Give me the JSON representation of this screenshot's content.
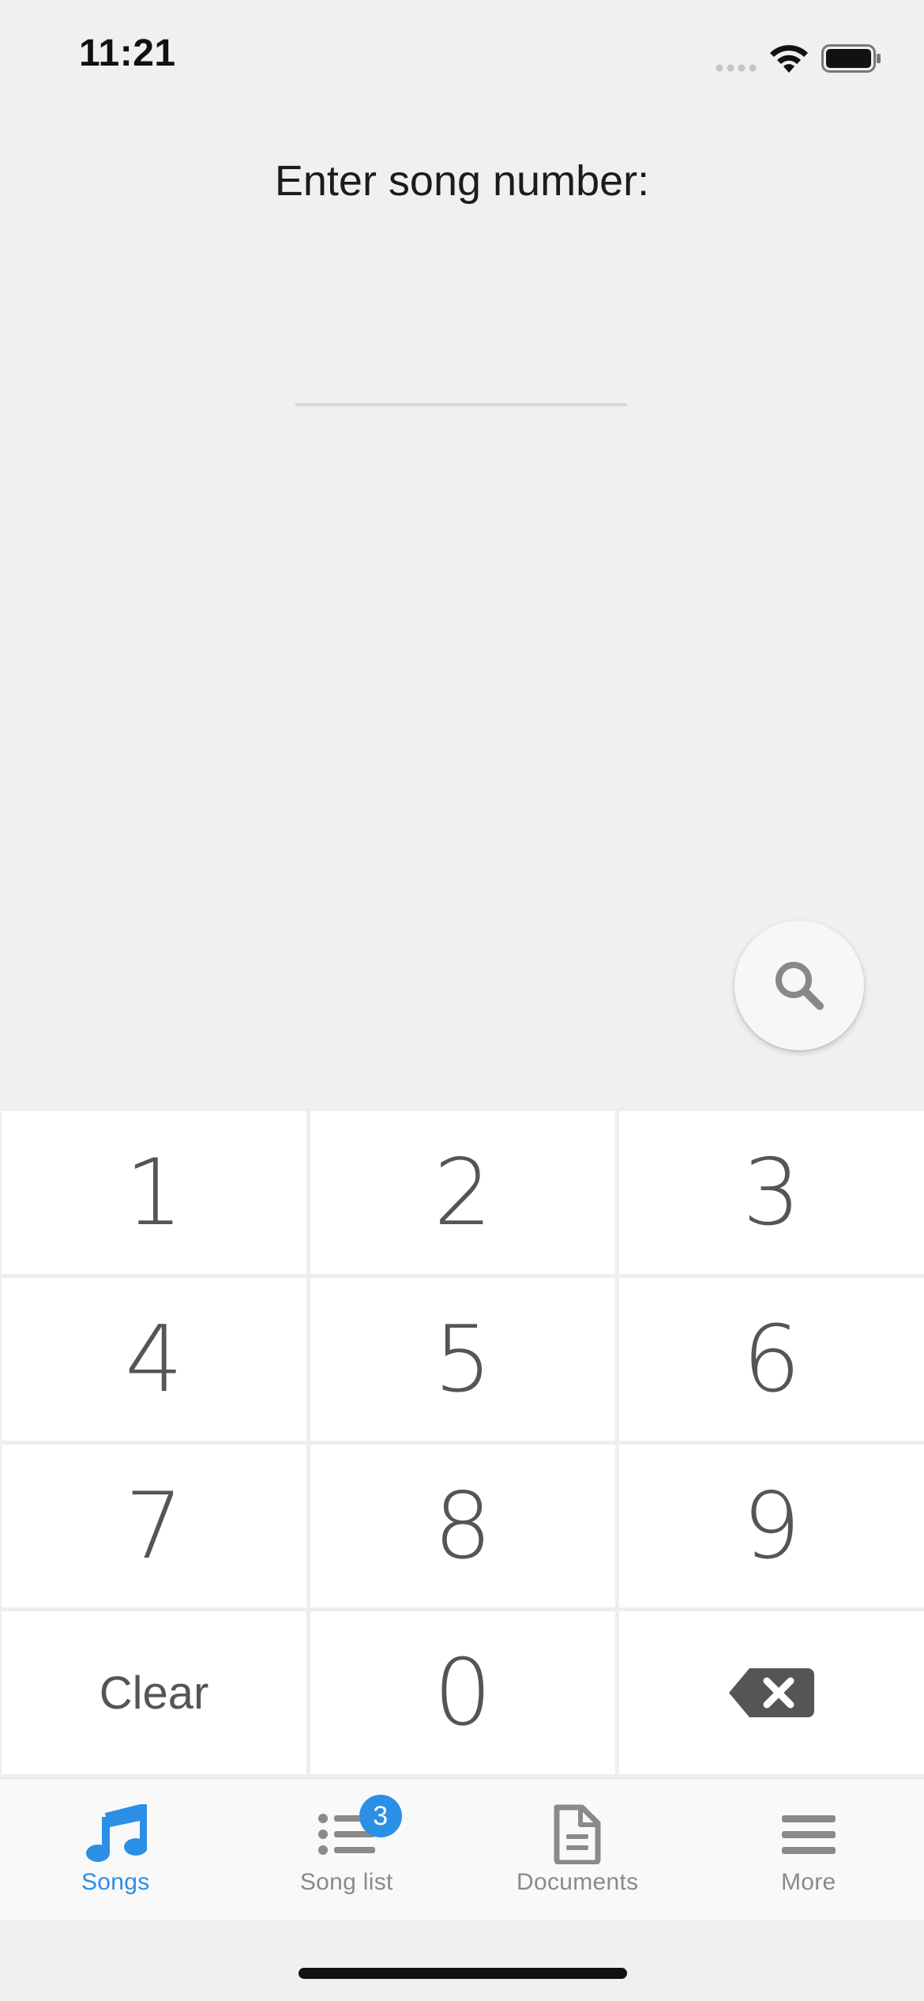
{
  "status_bar": {
    "time": "11:21",
    "signal_icon": "cellular-signal-icon",
    "wifi_icon": "wifi-icon",
    "battery_icon": "battery-icon"
  },
  "prompt": {
    "text": "Enter song number:"
  },
  "number_input": {
    "value": "",
    "placeholder": ""
  },
  "search_button": {
    "icon": "search-icon"
  },
  "keypad": {
    "keys": [
      "1",
      "2",
      "3",
      "4",
      "5",
      "6",
      "7",
      "8",
      "9",
      "Clear",
      "0"
    ],
    "backspace_icon": "backspace-icon"
  },
  "tabs": [
    {
      "label": "Songs",
      "icon": "music-note-icon",
      "active": true
    },
    {
      "label": "Song list",
      "icon": "list-icon",
      "badge": "3",
      "active": false
    },
    {
      "label": "Documents",
      "icon": "document-icon",
      "active": false
    },
    {
      "label": "More",
      "icon": "menu-icon",
      "active": false
    }
  ],
  "colors": {
    "accent": "#2b8fe6",
    "background": "#f0f0f0",
    "key_background": "#ffffff",
    "key_text": "#555555",
    "inactive_tab": "#8a8a8a"
  }
}
